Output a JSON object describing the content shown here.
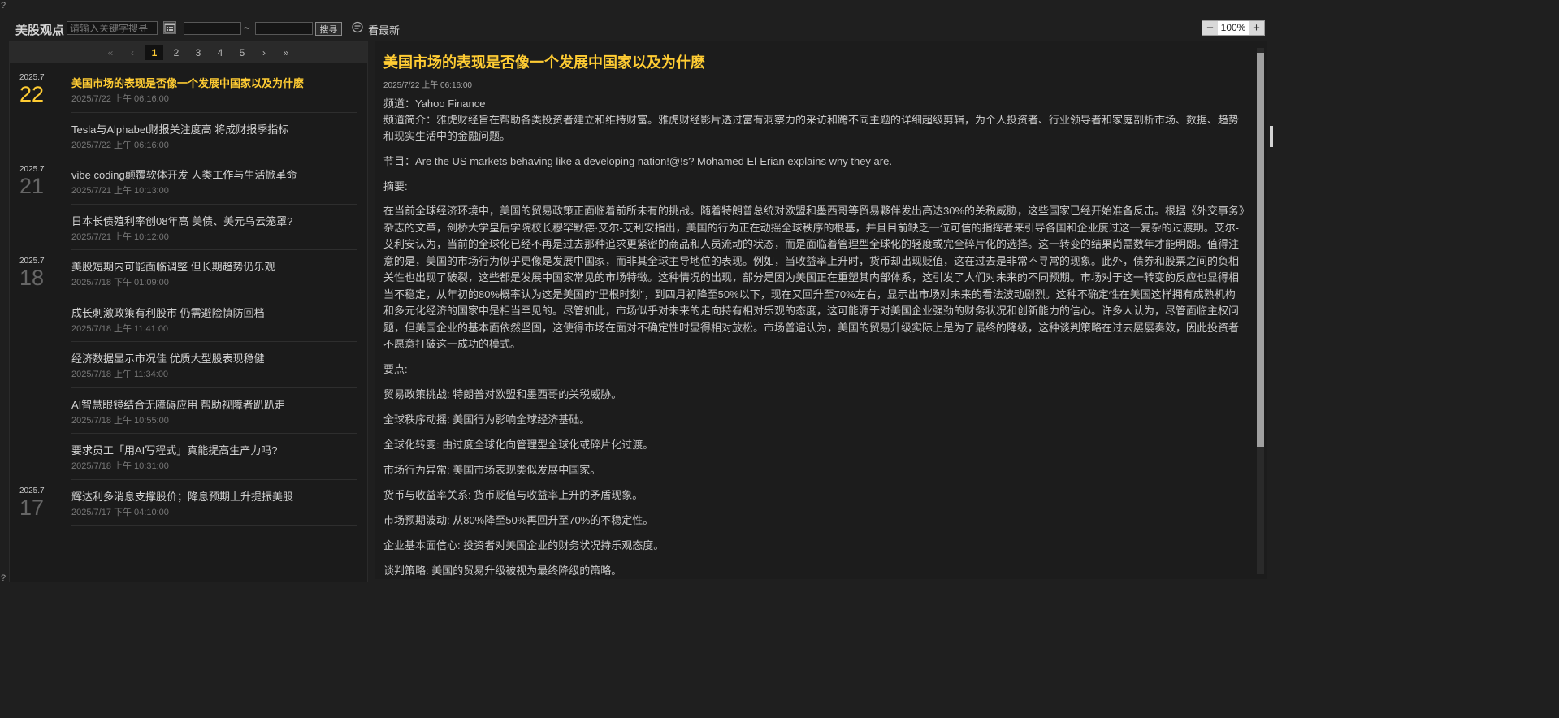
{
  "corner": {
    "top_left": "?",
    "bottom_left": "?"
  },
  "toolbar": {
    "title": "美股观点",
    "search_placeholder": "请输入关键字搜寻",
    "date_from": "",
    "date_to": "",
    "tilde": "~",
    "search_label": "搜寻",
    "latest_label": "看最新",
    "zoom_minus": "−",
    "zoom_value": "100%",
    "zoom_plus": "+"
  },
  "pager": {
    "first": "«",
    "prev": "‹",
    "pages": [
      "1",
      "2",
      "3",
      "4",
      "5"
    ],
    "current": "1",
    "next": "›",
    "last": "»"
  },
  "news": [
    {
      "ym": "2025.7",
      "day": "22",
      "title": "美国市场的表现是否像一个发展中国家以及为什麽",
      "time": "2025/7/22 上午 06:16:00",
      "active": true
    },
    {
      "ym": "",
      "day": "",
      "title": "Tesla与Alphabet财报关注度高 将成财报季指标",
      "time": "2025/7/22 上午 06:16:00"
    },
    {
      "ym": "2025.7",
      "day": "21",
      "title": "vibe coding颠覆软体开发 人类工作与生活掀革命",
      "time": "2025/7/21 上午 10:13:00"
    },
    {
      "ym": "",
      "day": "",
      "title": "日本长债殖利率创08年高 美债、美元乌云笼罩?",
      "time": "2025/7/21 上午 10:12:00"
    },
    {
      "ym": "2025.7",
      "day": "18",
      "title": "美股短期内可能面临调整 但长期趋势仍乐观",
      "time": "2025/7/18 下午 01:09:00"
    },
    {
      "ym": "",
      "day": "",
      "title": "成长刺激政策有利股市 仍需避险慎防回档",
      "time": "2025/7/18 上午 11:41:00"
    },
    {
      "ym": "",
      "day": "",
      "title": "经济数据显示市况佳 优质大型股表现稳健",
      "time": "2025/7/18 上午 11:34:00"
    },
    {
      "ym": "",
      "day": "",
      "title": "AI智慧眼镜结合无障碍应用 帮助视障者趴趴走",
      "time": "2025/7/18 上午 10:55:00"
    },
    {
      "ym": "",
      "day": "",
      "title": "要求员工「用AI写程式」真能提高生产力吗?",
      "time": "2025/7/18 上午 10:31:00"
    },
    {
      "ym": "2025.7",
      "day": "17",
      "title": "辉达利多消息支撑股价；降息预期上升提振美股",
      "time": "2025/7/17 下午 04:10:00"
    }
  ],
  "article": {
    "title": "美国市场的表现是否像一个发展中国家以及为什麽",
    "time": "2025/7/22 上午 06:16:00",
    "channel": "频道：Yahoo Finance",
    "intro": "频道简介：雅虎财经旨在帮助各类投资者建立和维持财富。雅虎财经影片透过富有洞察力的采访和跨不同主题的详细超级剪辑，为个人投资者、行业领导者和家庭剖析市场、数据、趋势和现实生活中的金融问题。",
    "program": "节目：Are the US markets behaving like a developing nation!@!s?   Mohamed El-Erian explains why they are.",
    "summary_label": "摘要:",
    "summary": "在当前全球经济环境中，美国的贸易政策正面临着前所未有的挑战。随着特朗普总统对欧盟和墨西哥等贸易夥伴发出高达30%的关税威胁，这些国家已经开始准备反击。根据《外交事务》杂志的文章，剑桥大学皇后学院校长穆罕默德·艾尔-艾利安指出，美国的行为正在动摇全球秩序的根基，并且目前缺乏一位可信的指挥者来引导各国和企业度过这一复杂的过渡期。艾尔-艾利安认为，当前的全球化已经不再是过去那种追求更紧密的商品和人员流动的状态，而是面临着管理型全球化的轻度或完全碎片化的选择。这一转变的结果尚需数年才能明朗。值得注意的是，美国的市场行为似乎更像是发展中国家，而非其全球主导地位的表现。例如，当收益率上升时，货币却出现贬值，这在过去是非常不寻常的现象。此外，债券和股票之间的负相关性也出现了破裂，这些都是发展中国家常见的市场特徵。这种情况的出现，部分是因为美国正在重塑其内部体系，这引发了人们对未来的不同预期。市场对于这一转变的反应也显得相当不稳定，从年初的80%概率认为这是美国的“里根时刻”，到四月初降至50%以下，现在又回升至70%左右，显示出市场对未来的看法波动剧烈。这种不确定性在美国这样拥有成熟机构和多元化经济的国家中是相当罕见的。尽管如此，市场似乎对未来的走向持有相对乐观的态度，这可能源于对美国企业强劲的财务状况和创新能力的信心。许多人认为，尽管面临主权问题，但美国企业的基本面依然坚固，这使得市场在面对不确定性时显得相对放松。市场普遍认为，美国的贸易升级实际上是为了最终的降级，这种谈判策略在过去屡屡奏效，因此投资者不愿意打破这一成功的模式。",
    "points_label": "要点:",
    "points": [
      "贸易政策挑战: 特朗普对欧盟和墨西哥的关税威胁。",
      "全球秩序动摇: 美国行为影响全球经济基础。",
      "全球化转变: 由过度全球化向管理型全球化或碎片化过渡。",
      "市场行为异常: 美国市场表现类似发展中国家。",
      "货币与收益率关系: 货币贬值与收益率上升的矛盾现象。",
      "市场预期波动: 从80%降至50%再回升至70%的不稳定性。",
      "企业基本面信心: 投资者对美国企业的财务状况持乐观态度。",
      "谈判策略: 美国的贸易升级被视为最终降级的策略。"
    ]
  },
  "colors": {
    "accent": "#ffcc33",
    "background": "#1f1f1f",
    "panel": "#1b1b1b",
    "muted_day": "#666666"
  }
}
